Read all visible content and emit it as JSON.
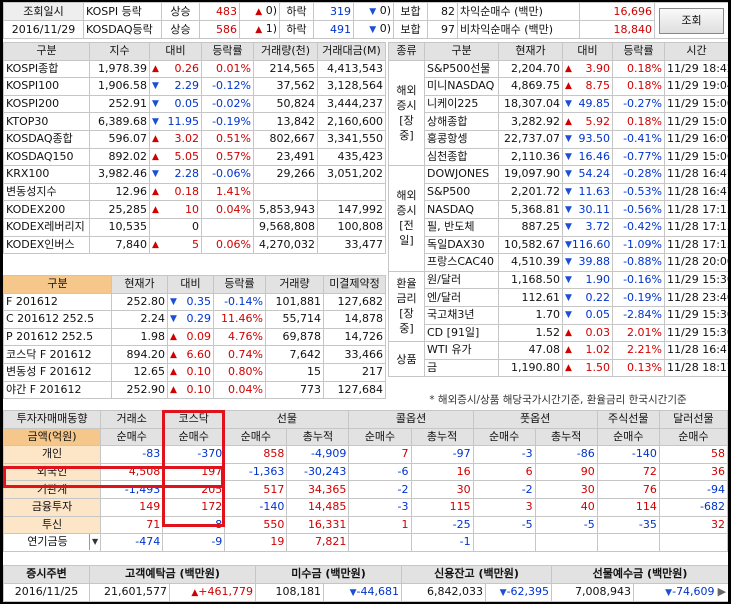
{
  "top": {
    "label_date": "조회일시",
    "date": "2016/11/29",
    "rows": [
      {
        "market": "KOSPI 등락",
        "up_label": "상승",
        "up": "483",
        "up_limit": "0",
        "down_label": "하락",
        "down": "319",
        "down_limit": "0",
        "flat_label": "보합",
        "flat": "82",
        "arb_label": "차익순매수 (백만)",
        "arb": "16,696"
      },
      {
        "market": "KOSDAQ등락",
        "up_label": "상승",
        "up": "586",
        "up_limit": "1",
        "down_label": "하락",
        "down": "491",
        "down_limit": "0",
        "flat_label": "보합",
        "flat": "97",
        "arb_label": "비차익순매수 (백만)",
        "arb": "18,840"
      }
    ],
    "query_button": "조회"
  },
  "index": {
    "headers": [
      "구분",
      "지수",
      "대비",
      "등락률",
      "거래량(천)",
      "거래대금(M)"
    ],
    "rows": [
      {
        "name": "KOSPI종합",
        "val": "1,978.39",
        "dir": "up",
        "chg": "0.26",
        "rate": "0.01%",
        "vol": "214,565",
        "amt": "4,413,543"
      },
      {
        "name": "KOSPI100",
        "val": "1,906.58",
        "dir": "dn",
        "chg": "2.29",
        "rate": "-0.12%",
        "vol": "37,562",
        "amt": "3,128,564"
      },
      {
        "name": "KOSPI200",
        "val": "252.91",
        "dir": "dn",
        "chg": "0.05",
        "rate": "-0.02%",
        "vol": "50,824",
        "amt": "3,444,237"
      },
      {
        "name": "KTOP30",
        "val": "6,389.68",
        "dir": "dn",
        "chg": "11.95",
        "rate": "-0.19%",
        "vol": "13,842",
        "amt": "2,160,600"
      },
      {
        "name": "KOSDAQ종합",
        "val": "596.07",
        "dir": "up",
        "chg": "3.02",
        "rate": "0.51%",
        "vol": "802,667",
        "amt": "3,341,550"
      },
      {
        "name": "KOSDAQ150",
        "val": "892.02",
        "dir": "up",
        "chg": "5.05",
        "rate": "0.57%",
        "vol": "23,491",
        "amt": "435,423"
      },
      {
        "name": "KRX100",
        "val": "3,982.46",
        "dir": "dn",
        "chg": "2.28",
        "rate": "-0.06%",
        "vol": "29,266",
        "amt": "3,051,202"
      },
      {
        "name": "변동성지수",
        "val": "12.96",
        "dir": "up",
        "chg": "0.18",
        "rate": "1.41%",
        "vol": "",
        "amt": ""
      },
      {
        "name": "KODEX200",
        "val": "25,285",
        "dir": "up",
        "chg": "10",
        "rate": "0.04%",
        "vol": "5,853,943",
        "amt": "147,992"
      },
      {
        "name": "KODEX레버리지",
        "val": "10,535",
        "dir": "",
        "chg": "0",
        "rate": "",
        "vol": "9,568,808",
        "amt": "100,808"
      },
      {
        "name": "KODEX인버스",
        "val": "7,840",
        "dir": "up",
        "chg": "5",
        "rate": "0.06%",
        "vol": "4,270,032",
        "amt": "33,477"
      }
    ]
  },
  "futures": {
    "headers": [
      "구분",
      "현재가",
      "대비",
      "등락률",
      "거래량",
      "미결제약정"
    ],
    "rows": [
      {
        "name": "F 201612",
        "val": "252.80",
        "dir": "dn",
        "chg": "0.35",
        "rate": "-0.14%",
        "vol": "101,881",
        "oi": "127,682"
      },
      {
        "name": "C 201612 252.5",
        "val": "2.24",
        "dir": "dn",
        "chg": "0.29",
        "rate": "11.46%",
        "vol": "55,714",
        "oi": "14,878"
      },
      {
        "name": "P 201612 252.5",
        "val": "1.98",
        "dir": "up",
        "chg": "0.09",
        "rate": "4.76%",
        "vol": "69,878",
        "oi": "14,726"
      },
      {
        "name": "코스닥 F 201612",
        "val": "894.20",
        "dir": "up",
        "chg": "6.60",
        "rate": "0.74%",
        "vol": "7,642",
        "oi": "33,466"
      },
      {
        "name": "변동성 F 201612",
        "val": "12.65",
        "dir": "up",
        "chg": "0.10",
        "rate": "0.80%",
        "vol": "15",
        "oi": "217"
      },
      {
        "name": "야간 F 201612",
        "val": "252.90",
        "dir": "up",
        "chg": "0.10",
        "rate": "0.04%",
        "vol": "773",
        "oi": "127,684"
      }
    ]
  },
  "overseas": {
    "headers": [
      "종류",
      "구분",
      "현재가",
      "대비",
      "등락률",
      "시간"
    ],
    "groups": [
      {
        "label": "해외증시[장중]",
        "rows": [
          {
            "name": "S&P500선물",
            "val": "2,204.70",
            "dir": "up",
            "chg": "3.90",
            "rate": "0.18%",
            "time": "11/29 18:42"
          },
          {
            "name": "미니NASDAQ",
            "val": "4,869.75",
            "dir": "up",
            "chg": "8.75",
            "rate": "0.18%",
            "time": "11/29 19:04"
          },
          {
            "name": "니케이225",
            "val": "18,307.04",
            "dir": "dn",
            "chg": "49.85",
            "rate": "-0.27%",
            "time": "11/29 15:00"
          },
          {
            "name": "상해종합",
            "val": "3,282.92",
            "dir": "up",
            "chg": "5.92",
            "rate": "0.18%",
            "time": "11/29 15:01"
          },
          {
            "name": "홍콩항셍",
            "val": "22,737.07",
            "dir": "dn",
            "chg": "93.50",
            "rate": "-0.41%",
            "time": "11/29 16:09"
          },
          {
            "name": "심천종합",
            "val": "2,110.36",
            "dir": "dn",
            "chg": "16.46",
            "rate": "-0.77%",
            "time": "11/29 15:06"
          }
        ]
      },
      {
        "label": "해외증시[전일]",
        "rows": [
          {
            "name": "DOWJONES",
            "val": "19,097.90",
            "dir": "dn",
            "chg": "54.24",
            "rate": "-0.28%",
            "time": "11/28 16:47"
          },
          {
            "name": "S&P500",
            "val": "2,201.72",
            "dir": "dn",
            "chg": "11.63",
            "rate": "-0.53%",
            "time": "11/28 16:47"
          },
          {
            "name": "NASDAQ",
            "val": "5,368.81",
            "dir": "dn",
            "chg": "30.11",
            "rate": "-0.56%",
            "time": "11/28 17:15"
          },
          {
            "name": "필, 반도체",
            "val": "887.25",
            "dir": "dn",
            "chg": "3.72",
            "rate": "-0.42%",
            "time": "11/28 17:15"
          },
          {
            "name": "독일DAX30",
            "val": "10,582.67",
            "dir": "dn",
            "chg": "116.60",
            "rate": "-1.09%",
            "time": "11/28 17:15"
          },
          {
            "name": "프랑스CAC40",
            "val": "4,510.39",
            "dir": "dn",
            "chg": "39.88",
            "rate": "-0.88%",
            "time": "11/28 20:00"
          }
        ]
      },
      {
        "label": "환율금리[장중]",
        "rows": [
          {
            "name": "원/달러",
            "val": "1,168.50",
            "dir": "dn",
            "chg": "1.90",
            "rate": "-0.16%",
            "time": "11/29 15:30"
          },
          {
            "name": "엔/달러",
            "val": "112.61",
            "dir": "dn",
            "chg": "0.22",
            "rate": "-0.19%",
            "time": "11/28 23:40"
          },
          {
            "name": "국고채3년",
            "val": "1.70",
            "dir": "dn",
            "chg": "0.05",
            "rate": "-2.84%",
            "time": "11/29 15:30"
          },
          {
            "name": "CD [91일]",
            "val": "1.52",
            "dir": "up",
            "chg": "0.03",
            "rate": "2.01%",
            "time": "11/29 15:30"
          }
        ]
      },
      {
        "label": "상품",
        "rows": [
          {
            "name": "WTI 유가",
            "val": "47.08",
            "dir": "up",
            "chg": "1.02",
            "rate": "2.21%",
            "time": "11/28 16:47"
          },
          {
            "name": "금",
            "val": "1,190.80",
            "dir": "up",
            "chg": "1.50",
            "rate": "0.13%",
            "time": "11/28 18:17"
          }
        ]
      }
    ],
    "note": "* 해외증시/상품 해당국가시간기준, 환율금리 한국시간기준"
  },
  "investor": {
    "title": "투자자매매동향",
    "unit": "금액(억원)",
    "groups": [
      "거래소",
      "코스닥",
      "선물",
      "콜옵션",
      "풋옵션",
      "주식선물",
      "달러선물"
    ],
    "sub": [
      "순매수",
      "순매수",
      "순매수",
      "총누적",
      "순매수",
      "총누적",
      "순매수",
      "총누적",
      "순매수",
      "순매수"
    ],
    "rows": [
      {
        "name": "개인",
        "v": [
          "-83",
          "-370",
          "858",
          "-4,909",
          "7",
          "-97",
          "-3",
          "-86",
          "-140",
          "58"
        ]
      },
      {
        "name": "외국인",
        "v": [
          "4,508",
          "197",
          "-1,363",
          "-30,243",
          "-6",
          "16",
          "6",
          "90",
          "72",
          "36"
        ]
      },
      {
        "name": "기관계",
        "v": [
          "-1,493",
          "205",
          "517",
          "34,365",
          "-2",
          "30",
          "-2",
          "30",
          "76",
          "-94"
        ]
      },
      {
        "name": "금융투자",
        "v": [
          "149",
          "172",
          "-140",
          "14,485",
          "-3",
          "115",
          "3",
          "40",
          "114",
          "-682"
        ]
      },
      {
        "name": "투신",
        "v": [
          "71",
          "-8",
          "550",
          "16,331",
          "1",
          "-25",
          "-5",
          "-5",
          "-35",
          "32"
        ]
      },
      {
        "name": "연기금등",
        "v": [
          "-474",
          "-9",
          "19",
          "7,821",
          "",
          "-1",
          "",
          "",
          "",
          ""
        ]
      }
    ]
  },
  "bottom": {
    "headers": [
      "증시주변",
      "고객예탁금 (백만원)",
      "미수금 (백만원)",
      "신용잔고 (백만원)",
      "선물예수금 (백만원)"
    ],
    "date": "2016/11/25",
    "deposit": "21,601,577",
    "deposit_chg": "+461,779",
    "unpaid": "108,181",
    "unpaid_chg": "-44,681",
    "credit": "6,842,033",
    "credit_chg": "-62,395",
    "fut_dep": "7,008,943",
    "fut_dep_chg": "-74,609"
  }
}
